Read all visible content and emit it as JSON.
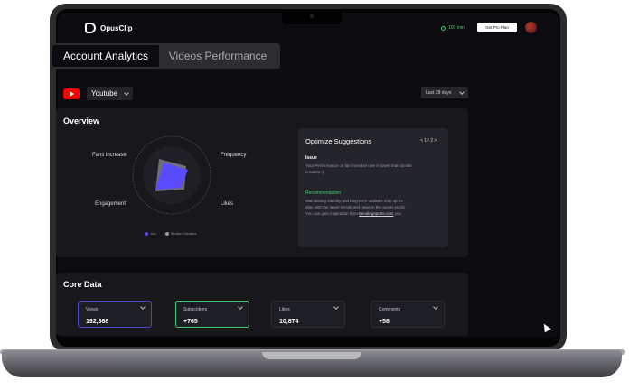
{
  "app": {
    "name": "OpusClip"
  },
  "header": {
    "credits": "100 min",
    "upgrade_label": "Get Pro Plan"
  },
  "tabs": [
    {
      "label": "Account Analytics",
      "active": true
    },
    {
      "label": "Videos Performance",
      "active": false
    }
  ],
  "platform": {
    "name": "Youtube",
    "date_range": "Last 28 days"
  },
  "overview": {
    "title": "Overview",
    "radar": {
      "axes": [
        "Fans increase",
        "Frequency",
        "Likes",
        "Engagement"
      ],
      "legend": [
        "You",
        "Similar Creators"
      ],
      "colors": {
        "you": "#5b4bff",
        "similar": "#9b9ba3"
      }
    },
    "suggestions": {
      "title": "Optimize Suggestions",
      "pager": "< 1 / 2 >",
      "issue_label": "Issue",
      "issue_text": "Your Performance on fan increase rate is lower than similar creators :(",
      "recommendation_label": "Recommendation",
      "recommendation_text": "Maintaining stability and long-term updates may up-to-date with the latest trends and news in the sports world. You can gain inspiration from",
      "recommendation_link": "trendingsports.com",
      "recommendation_tail": "you"
    }
  },
  "core_data": {
    "title": "Core Data",
    "metrics": [
      {
        "label": "Views",
        "value": "192,368"
      },
      {
        "label": "Subscribers",
        "value": "+765"
      },
      {
        "label": "Likes",
        "value": "10,874"
      },
      {
        "label": "Comments",
        "value": "+58"
      }
    ]
  },
  "colors": {
    "accent": "#5b4bff",
    "positive": "#3ecf6a",
    "youtube": "#ff0000"
  }
}
